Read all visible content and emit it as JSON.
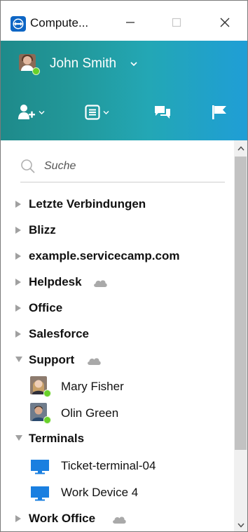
{
  "window": {
    "title": "Compute...",
    "controls": {
      "minimize": "—",
      "maximize": "☐",
      "close": "✕"
    }
  },
  "header": {
    "user_name": "John Smith",
    "user_status": "online",
    "toolbar": [
      {
        "icon": "add-contact-icon",
        "has_dropdown": true
      },
      {
        "icon": "list-view-icon",
        "has_dropdown": true
      },
      {
        "icon": "chat-icon",
        "has_dropdown": false
      },
      {
        "icon": "flag-icon",
        "has_dropdown": false
      }
    ]
  },
  "search": {
    "placeholder": "Suche"
  },
  "tree": {
    "groups": [
      {
        "label": "Letzte Verbindungen",
        "expanded": false,
        "cloud": false
      },
      {
        "label": "Blizz",
        "expanded": false,
        "cloud": false
      },
      {
        "label": "example.servicecamp.com",
        "expanded": false,
        "cloud": false
      },
      {
        "label": "Helpdesk",
        "expanded": false,
        "cloud": true
      },
      {
        "label": "Office",
        "expanded": false,
        "cloud": false
      },
      {
        "label": "Salesforce",
        "expanded": false,
        "cloud": false
      },
      {
        "label": "Support",
        "expanded": true,
        "cloud": true,
        "items": [
          {
            "label": "Mary Fisher",
            "type": "contact",
            "status": "online"
          },
          {
            "label": "Olin Green",
            "type": "contact",
            "status": "online"
          }
        ]
      },
      {
        "label": "Terminals",
        "expanded": true,
        "cloud": false,
        "items": [
          {
            "label": "Ticket-terminal-04",
            "type": "computer"
          },
          {
            "label": "Work Device 4",
            "type": "computer"
          }
        ]
      },
      {
        "label": "Work Office",
        "expanded": false,
        "cloud": true
      }
    ]
  },
  "colors": {
    "header_gradient_start": "#1e8a8a",
    "header_gradient_end": "#1f9ed6",
    "online_status": "#69d12a",
    "device_blue": "#1a7fe0"
  }
}
